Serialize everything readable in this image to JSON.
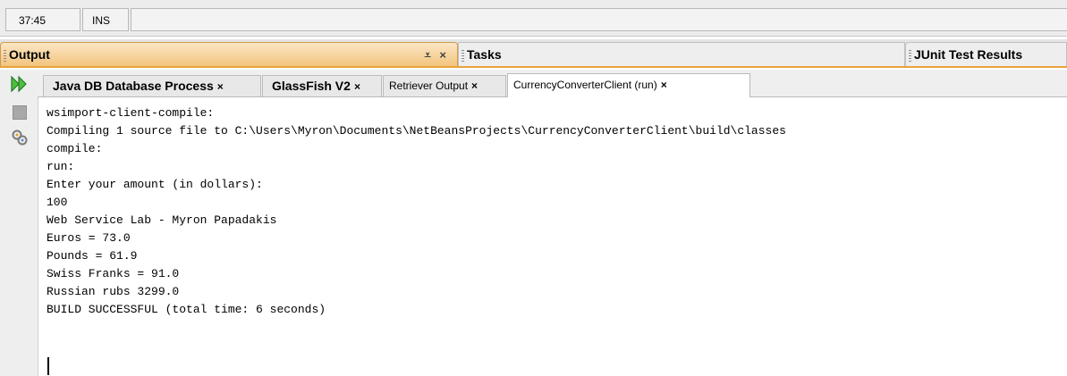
{
  "statusbar": {
    "position": "37:45",
    "mode": "INS"
  },
  "window_tabs": {
    "output": "Output",
    "tasks": "Tasks",
    "junit": "JUnit Test Results",
    "minimize_glyph": "⩡",
    "close_glyph": "×"
  },
  "toolbar": {
    "rerun_icon": "rerun-icon",
    "stop_icon": "stop-icon",
    "settings_icon": "settings-icon"
  },
  "subtabs": [
    {
      "label": "Java DB Database Process",
      "close": "×"
    },
    {
      "label": "GlassFish V2",
      "close": "×"
    },
    {
      "label": "Retriever Output",
      "close": "×"
    },
    {
      "label": "CurrencyConverterClient (run)",
      "close": "×"
    }
  ],
  "console": {
    "lines": [
      "wsimport-client-compile:",
      "Compiling 1 source file to C:\\Users\\Myron\\Documents\\NetBeansProjects\\CurrencyConverterClient\\build\\classes",
      "compile:",
      "run:",
      "Enter your amount (in dollars):",
      "100",
      "Web Service Lab - Myron Papadakis",
      "Euros = 73.0",
      "Pounds = 61.9",
      "Swiss Franks = 91.0",
      "Russian rubs 3299.0",
      "BUILD SUCCESSFUL (total time: 6 seconds)"
    ]
  },
  "colors": {
    "active_tab_accent": "#f3c47d",
    "rerun_green": "#2d9a2d"
  }
}
